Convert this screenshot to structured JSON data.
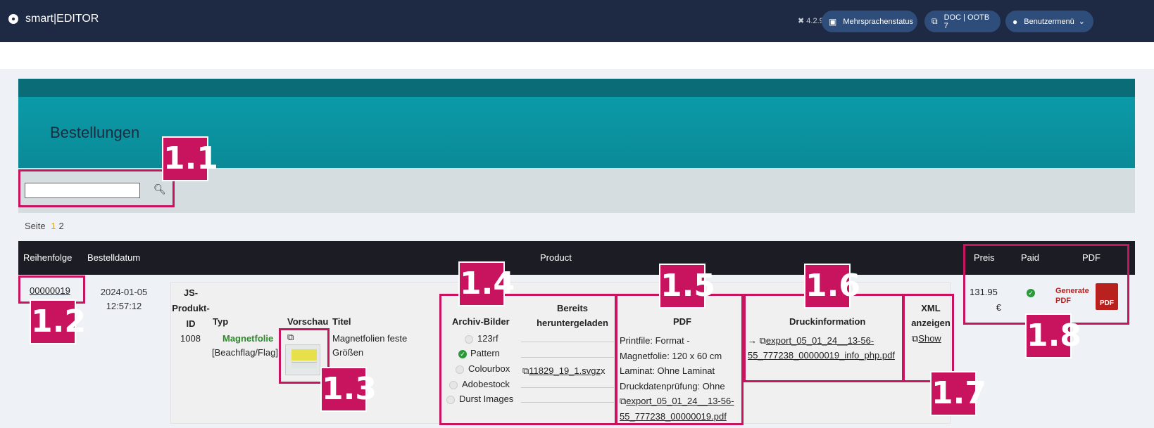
{
  "topbar": {
    "app_title": "smart|EDITOR",
    "version": "4.2.9",
    "lang_status": "Mehrsprachenstatus",
    "doc": "DOC | OOTB 7",
    "user_menu": "Benutzermenü"
  },
  "page": {
    "heading": "Bestellungen",
    "search_value": ""
  },
  "pager": {
    "label": "Seite",
    "current": "1",
    "other": "2"
  },
  "table": {
    "headers": {
      "order": "Reihenfolge",
      "date": "Bestelldatum",
      "product": "Product",
      "price": "Preis",
      "paid": "Paid",
      "pdf": "PDF"
    },
    "row": {
      "order_no": "00000019",
      "date": "2024-01-05",
      "time": "12:57:12",
      "price_value": "131.95",
      "price_currency": "€",
      "pdf_action_line1": "Generate",
      "pdf_action_line2": "PDF"
    }
  },
  "product": {
    "headers": {
      "js_id_1": "JS-",
      "js_id_2": "Produkt-",
      "js_id_3": "ID",
      "type": "Typ",
      "preview": "Vorschau",
      "title": "Titel",
      "archive": "Archiv-Bilder",
      "downloaded_1": "Bereits",
      "downloaded_2": "heruntergeladen",
      "pdf": "PDF",
      "print": "Druckinformation",
      "xml_1": "XML",
      "xml_2": "anzeigen"
    },
    "id": "1008",
    "type_name": "Magnetfolie",
    "type_sub": "[Beachflag/Flag]",
    "title_1": "Magnetfolien feste",
    "title_2": "Größen",
    "archive_items": [
      "123rf",
      "Pattern",
      "Colourbox",
      "Adobestock",
      "Durst Images"
    ],
    "archive_checked": "Pattern",
    "downloaded_file": "11829_19_1.svgz",
    "downloaded_x": "x",
    "pdf_lines": [
      "Printfile: Format -",
      "Magnetfolie: 120 x 60 cm",
      "Laminat: Ohne Laminat",
      "Druckdatenprüfung: Ohne"
    ],
    "pdf_link_1": "export_05_01_24__13-56-",
    "pdf_link_2": "55_777238_00000019.pdf",
    "print_arrow": "→",
    "print_link_1": "export_05_01_24__13-56-",
    "print_link_2": "55_777238_00000019_info_php.pdf",
    "xml_link": "Show"
  },
  "callouts": [
    "1.1",
    "1.2",
    "1.3",
    "1.4",
    "1.5",
    "1.6",
    "1.7",
    "1.8"
  ],
  "colors": {
    "topbar": "#1e2a43",
    "teal": "#0b9aa8",
    "callout": "#c8135f",
    "header": "#1b1c24"
  }
}
